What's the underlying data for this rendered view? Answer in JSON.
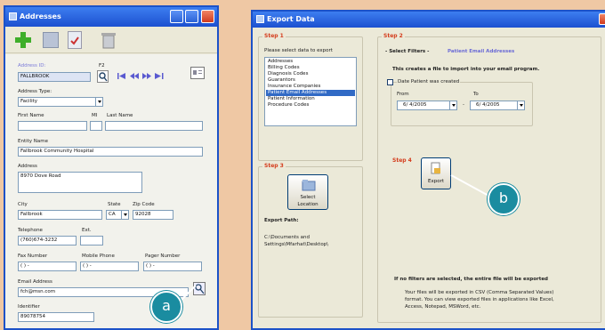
{
  "addresses": {
    "title": "Addresses",
    "fields": {
      "address_id_label": "Address ID:",
      "address_id_value": "FALLBROOK",
      "f2_label": "F2",
      "address_type_label": "Address Type:",
      "address_type_value": "Facility",
      "first_name_label": "First Name",
      "mi_label": "MI",
      "last_name_label": "Last Name",
      "entity_name_label": "Entity Name",
      "entity_name_value": "Fallbrook Community Hospital",
      "address_label": "Address",
      "address_value": "8970 Dove Road",
      "city_label": "City",
      "city_value": "Fallbrook",
      "state_label": "State",
      "state_value": "CA",
      "zip_label": "Zip Code",
      "zip_value": "92028",
      "telephone_label": "Telephone",
      "telephone_value": "(760)674-3232",
      "ext_label": "Ext.",
      "fax_label": "Fax Number",
      "fax_value": "( ) -",
      "mobile_label": "Mobile Phone",
      "mobile_value": "( ) -",
      "pager_label": "Pager Number",
      "pager_value": "( ) -",
      "email_label": "Email Address",
      "email_value": "fch@msn.com",
      "identifier_label": "Identifier",
      "identifier_value": "89078754"
    }
  },
  "export": {
    "title": "Export Data",
    "step1": {
      "title": "Step 1",
      "prompt": "Please select data to export",
      "items": [
        "Addresses",
        "Billing Codes",
        "Diagnosis Codes",
        "Guarantors",
        "Insurance Companies",
        "Patient Email Addresses",
        "Patient Information",
        "Procedure Codes"
      ],
      "selected_index": 5
    },
    "step2": {
      "title": "Step 2",
      "filters_label": "- Select Filters -",
      "filter_name": "Patient Email Addresses",
      "description": "This creates a file to import into your email program.",
      "date_group_label": "Date Patient was created",
      "from_label": "From",
      "from_value": "6/ 4/2005",
      "to_label": "To",
      "to_value": "6/ 4/2005",
      "dash": "-"
    },
    "step3": {
      "title": "Step 3",
      "select_label_line1": "Select",
      "select_label_line2": "Location",
      "export_path_label": "Export Path:",
      "export_path_line1": "C:\\Documents and",
      "export_path_line2": "Settings\\Mfarhat\\Desktop\\"
    },
    "step4": {
      "title": "Step 4",
      "export_label": "Export"
    },
    "note_bold": "If no filters are selected, the entire file will be exported",
    "note_line1": "Your files will be exported in CSV (Comma Separated Values)",
    "note_line2": "format. You can view exported files in applications like Excel,",
    "note_line3": "Access, Notepad, MSWord, etc."
  },
  "callouts": {
    "a": "a",
    "b": "b"
  },
  "colors": {
    "title_bar": "#1c50d0",
    "step_title": "#d43c1c",
    "callout": "#1a8ca0",
    "background": "#efc8a4"
  }
}
